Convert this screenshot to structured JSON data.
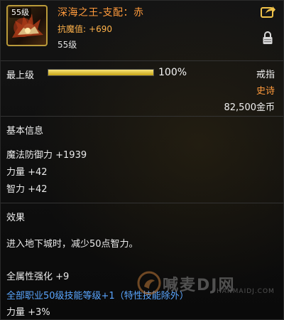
{
  "header": {
    "level_badge": "55级",
    "item_name": "深海之王-支配：赤",
    "anti_magic_label": "抗魔值:",
    "anti_magic_value": "+690",
    "required_level": "55级",
    "share_icon": "share-arrow-icon",
    "lock_icon": "padlock-icon"
  },
  "grade": {
    "label": "最上级",
    "percent_text": "100%",
    "fill_fraction": 1.0,
    "bar_color": "#d9be2a"
  },
  "item_meta": {
    "type": "戒指",
    "rarity": "史诗",
    "rarity_color": "#ff9a3c",
    "price": "82,500金币"
  },
  "basic_info": {
    "title": "基本信息",
    "stats": [
      "魔法防御力 +1939",
      "力量 +42",
      "智力 +42"
    ]
  },
  "effects": {
    "title": "效果",
    "description": "进入地下城时，减少50点智力。",
    "bonuses": [
      "全属性强化 +9",
      "全部职业50级技能等级+1（特性技能除外）",
      "力量 +3%"
    ],
    "skill_line_color": "#5aa6ff"
  },
  "watermark": {
    "text": "喊麦DJ网",
    "url": "HANMAIDJ.COM"
  }
}
